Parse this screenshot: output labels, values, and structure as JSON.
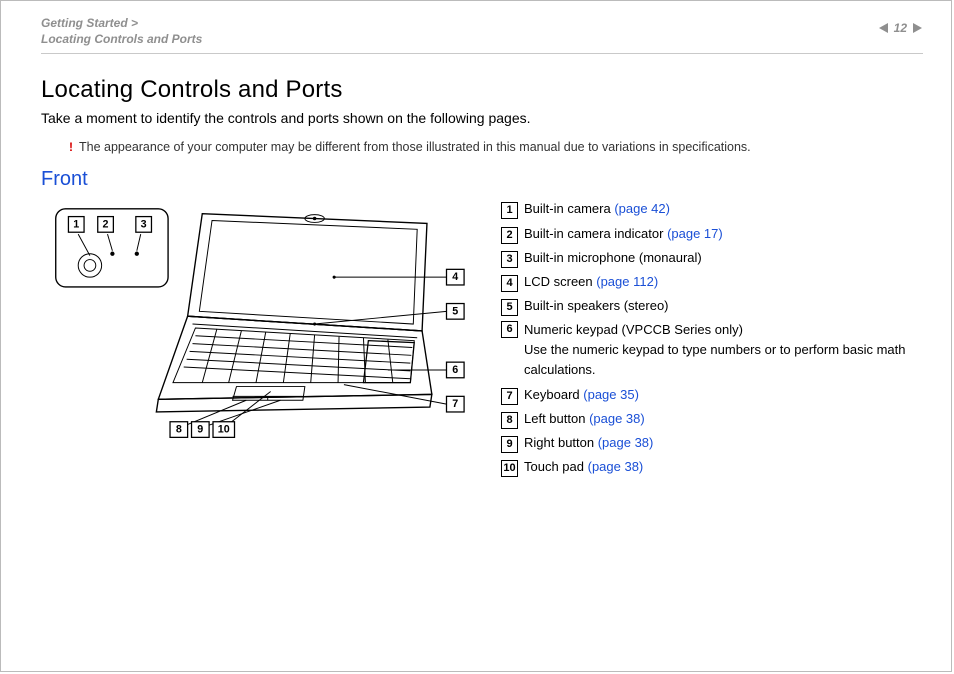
{
  "header": {
    "breadcrumb_line1": "Getting Started >",
    "breadcrumb_line2": "Locating Controls and Ports",
    "page_number": "12"
  },
  "title": "Locating Controls and Ports",
  "intro": "Take a moment to identify the controls and ports shown on the following pages.",
  "note_bang": "!",
  "note": "The appearance of your computer may be different from those illustrated in this manual due to variations in specifications.",
  "section": "Front",
  "callouts": {
    "c1": "1",
    "c2": "2",
    "c3": "3",
    "c4": "4",
    "c5": "5",
    "c6": "6",
    "c7": "7",
    "c8": "8",
    "c9": "9",
    "c10": "10"
  },
  "legend": [
    {
      "num": "1",
      "text": "Built-in camera ",
      "link": "(page 42)"
    },
    {
      "num": "2",
      "text": "Built-in camera indicator ",
      "link": "(page 17)"
    },
    {
      "num": "3",
      "text": "Built-in microphone (monaural)",
      "link": ""
    },
    {
      "num": "4",
      "text": "LCD screen ",
      "link": "(page 112)"
    },
    {
      "num": "5",
      "text": "Built-in speakers (stereo)",
      "link": ""
    },
    {
      "num": "6",
      "text": "Numeric keypad (VPCCB Series only)",
      "link": "",
      "extra": "Use the numeric keypad to type numbers or to perform basic math calculations."
    },
    {
      "num": "7",
      "text": "Keyboard ",
      "link": "(page 35)"
    },
    {
      "num": "8",
      "text": "Left button ",
      "link": "(page 38)"
    },
    {
      "num": "9",
      "text": "Right button ",
      "link": "(page 38)"
    },
    {
      "num": "10",
      "text": "Touch pad ",
      "link": "(page 38)"
    }
  ]
}
